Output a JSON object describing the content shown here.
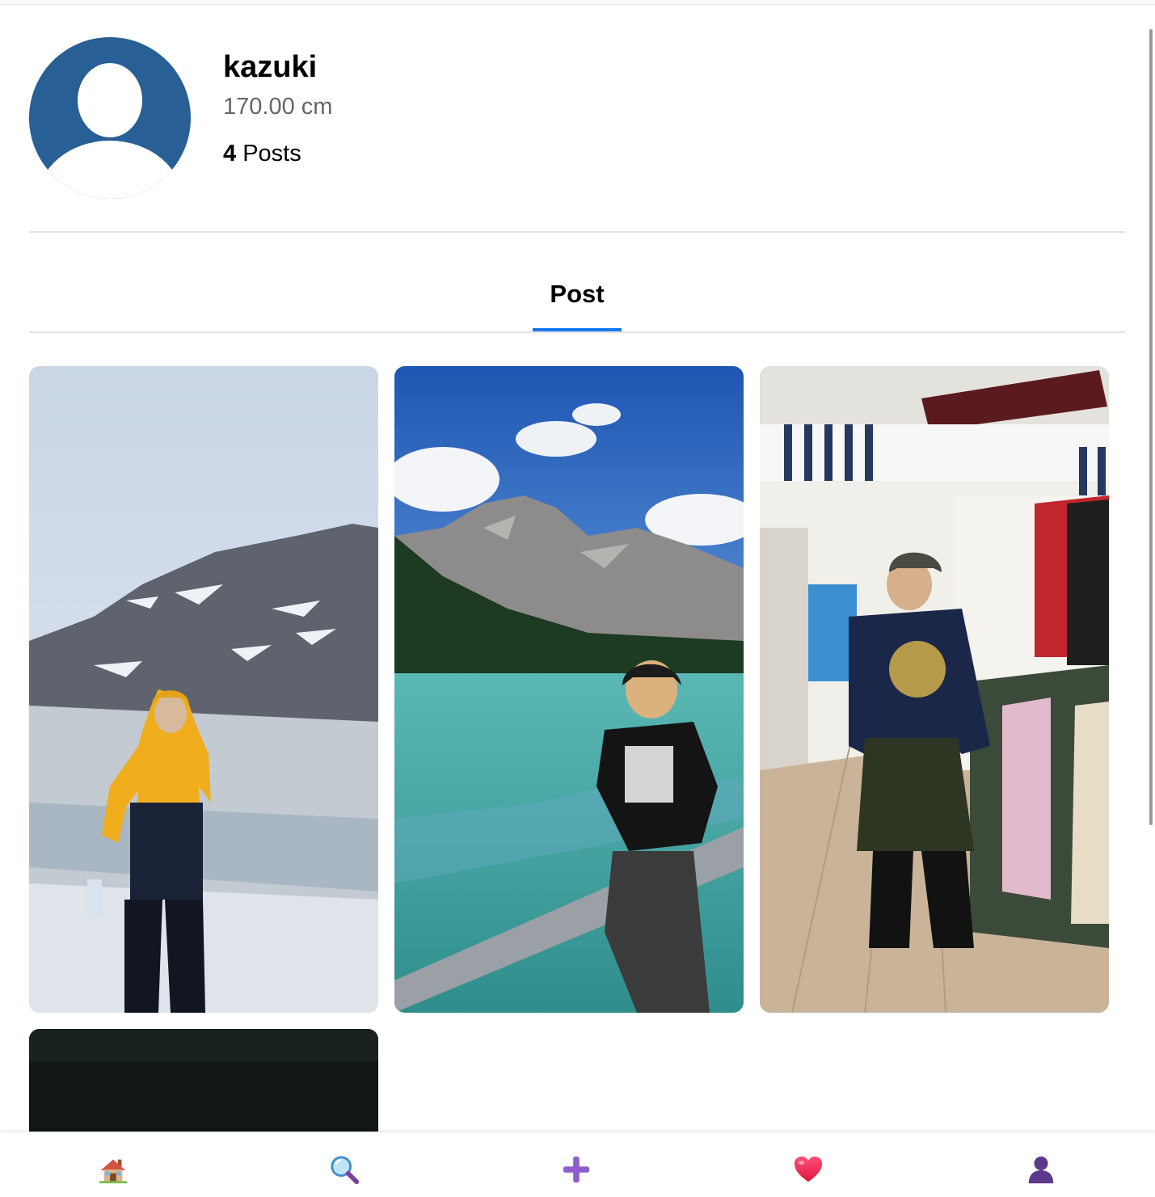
{
  "profile": {
    "username": "kazuki",
    "height_text": "170.00 cm",
    "post_count": "4",
    "post_label": "Posts"
  },
  "tabs": [
    {
      "label": "Post",
      "active": true
    }
  ],
  "accent_color": "#1877f2",
  "avatar_color": "#285f94",
  "posts": [
    {
      "icon": "glacier-photo"
    },
    {
      "icon": "lake-mountain-photo"
    },
    {
      "icon": "clothing-store-photo"
    },
    {
      "icon": "dark-photo"
    }
  ],
  "bottom_nav": [
    {
      "icon": "home-icon"
    },
    {
      "icon": "search-icon"
    },
    {
      "icon": "plus-icon"
    },
    {
      "icon": "heart-icon"
    },
    {
      "icon": "profile-icon"
    }
  ]
}
